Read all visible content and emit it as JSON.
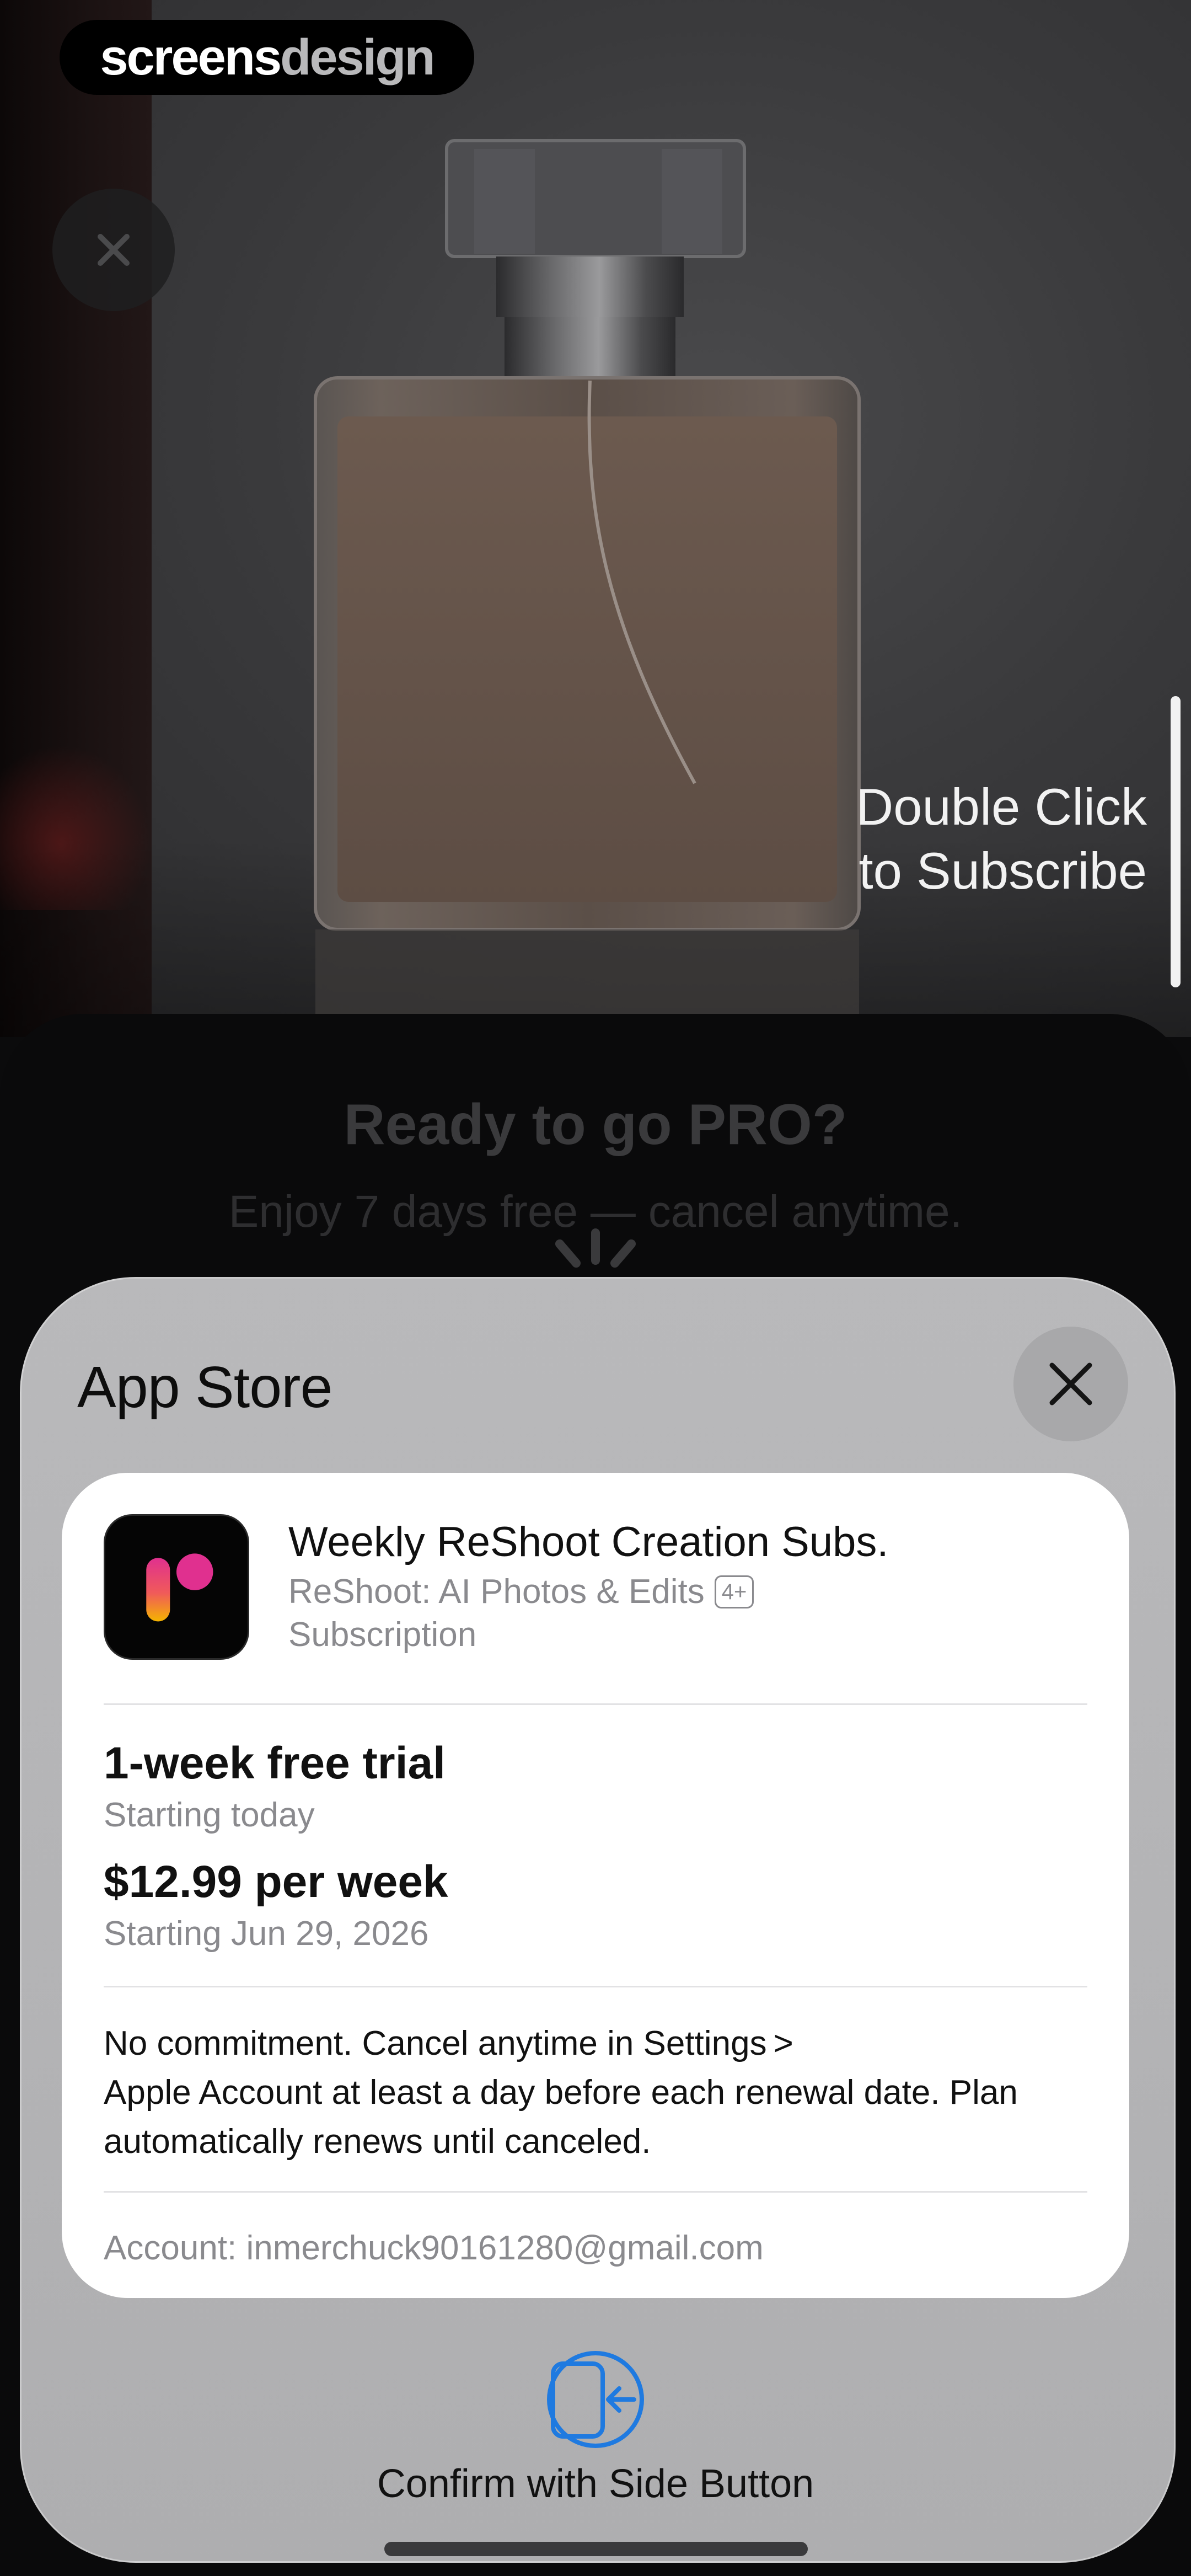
{
  "branding": {
    "part1": "screens",
    "part2": "design"
  },
  "hint": {
    "line1": "Double Click",
    "line2": "to Subscribe"
  },
  "paywall": {
    "title": "Ready to go PRO?",
    "subtitle": "Enjoy 7 days free — cancel anytime."
  },
  "store_sheet": {
    "title": "App Store",
    "product": {
      "name": "Weekly ReShoot Creation Subs.",
      "app_name": "ReShoot: AI Photos & Edits",
      "age_rating": "4+",
      "type": "Subscription"
    },
    "trial": {
      "title": "1-week free trial",
      "subtitle": "Starting today"
    },
    "price": {
      "title": "$12.99 per week",
      "subtitle": "Starting Jun 29, 2026"
    },
    "terms": {
      "line1": "No commitment. Cancel anytime in Settings",
      "chevron": ">",
      "rest": "Apple Account at least a day before each renewal date. Plan automatically renews until canceled."
    },
    "account": "Account: inmerchuck90161280@gmail.com",
    "confirm_label": "Confirm with Side Button"
  },
  "colors": {
    "accent_blue": "#1f7ae0",
    "icon_gradient_top": "#e0308f",
    "icon_gradient_bottom": "#f5b400"
  },
  "icons": {
    "close": "close-icon",
    "side_button": "side-button-icon",
    "spinner": "loading-spinner-icon",
    "app_icon": "reshoot-app-icon"
  }
}
